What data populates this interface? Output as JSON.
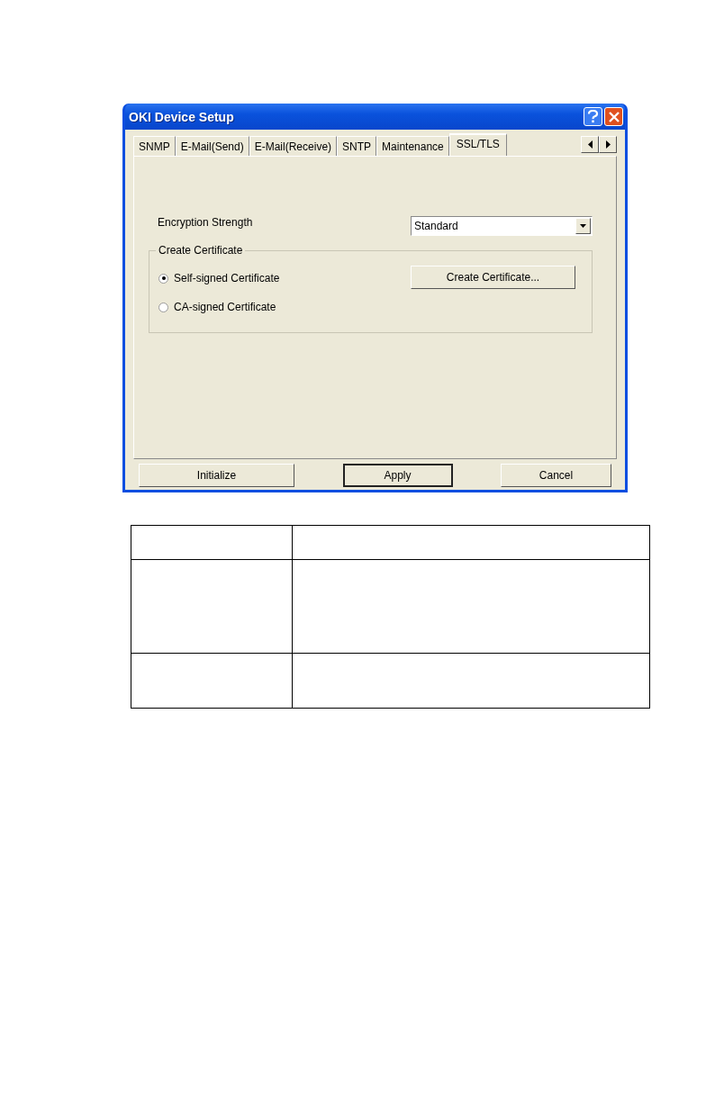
{
  "window": {
    "title": "OKI Device Setup"
  },
  "tabs": [
    {
      "label": "SNMP",
      "selected": false
    },
    {
      "label": "E-Mail(Send)",
      "selected": false
    },
    {
      "label": "E-Mail(Receive)",
      "selected": false
    },
    {
      "label": "SNTP",
      "selected": false
    },
    {
      "label": "Maintenance",
      "selected": false
    },
    {
      "label": "SSL/TLS",
      "selected": true
    }
  ],
  "encryption": {
    "label": "Encryption Strength",
    "value": "Standard"
  },
  "certificate_group": {
    "title": "Create Certificate",
    "options": [
      {
        "label": "Self-signed Certificate",
        "selected": true
      },
      {
        "label": "CA-signed Certificate",
        "selected": false
      }
    ],
    "button": "Create Certificate..."
  },
  "buttons": [
    {
      "label": "Initialize",
      "default": false
    },
    {
      "label": "Apply",
      "default": true
    },
    {
      "label": "Cancel",
      "default": false
    }
  ]
}
